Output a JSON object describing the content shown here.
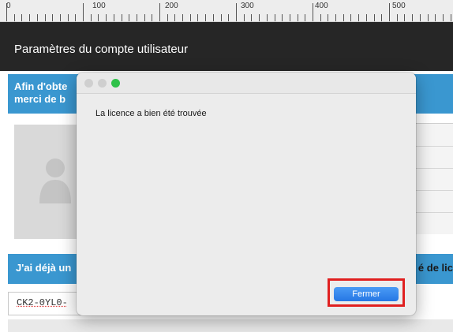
{
  "ruler": {
    "labels": [
      "0",
      "100",
      "200",
      "300",
      "400",
      "500"
    ]
  },
  "header": {
    "title": "Paramètres du compte utilisateur"
  },
  "info_banner": {
    "line1": "Afin d'obte",
    "line2": "merci de b"
  },
  "license_bar": {
    "left_text": "J'ai déjà un",
    "right_text": "é de lic"
  },
  "license_input": {
    "value": "CK2-0YL0-"
  },
  "dialog": {
    "message": "La licence a bien été trouvée",
    "close_label": "Fermer"
  },
  "colors": {
    "header_bg": "#262626",
    "banner_blue": "#3a97d0",
    "button_blue": "#2677e4",
    "highlight_red": "#e02020",
    "traffic_green": "#2fc24a"
  }
}
